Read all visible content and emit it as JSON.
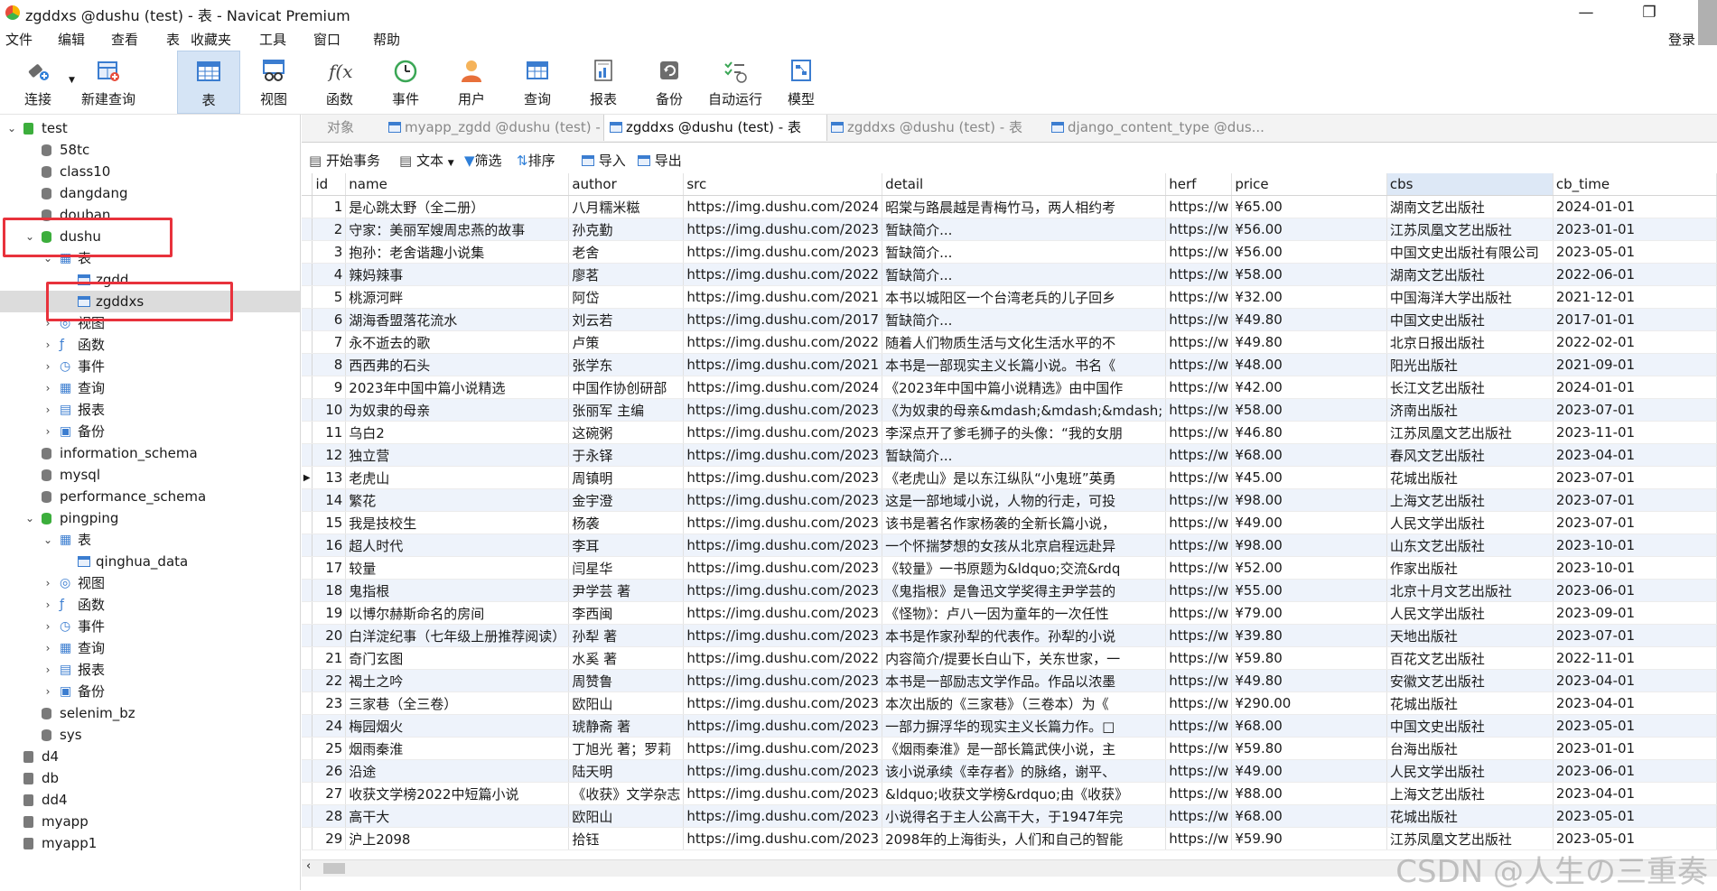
{
  "window": {
    "title": "zgddxs @dushu (test) - 表 - Navicat Premium",
    "minimize": "—",
    "maximize": "❐",
    "close": ""
  },
  "menu": [
    "文件",
    "编辑",
    "查看",
    "表",
    "收藏夹",
    "工具",
    "窗口",
    "帮助"
  ],
  "login": "登录",
  "toolbar": [
    {
      "label": "连接",
      "icon": "plug-icon"
    },
    {
      "label": "新建查询",
      "icon": "new-query-icon"
    },
    {
      "label": "表",
      "icon": "table-icon"
    },
    {
      "label": "视图",
      "icon": "view-icon"
    },
    {
      "label": "函数",
      "icon": "function-icon"
    },
    {
      "label": "事件",
      "icon": "clock-icon"
    },
    {
      "label": "用户",
      "icon": "user-icon"
    },
    {
      "label": "查询",
      "icon": "query-icon"
    },
    {
      "label": "报表",
      "icon": "report-icon"
    },
    {
      "label": "备份",
      "icon": "backup-icon"
    },
    {
      "label": "自动运行",
      "icon": "autorun-icon"
    },
    {
      "label": "模型",
      "icon": "model-icon"
    }
  ],
  "tree": [
    {
      "label": "test",
      "level": 0,
      "type": "conn"
    },
    {
      "label": "58tc",
      "level": 1,
      "type": "db"
    },
    {
      "label": "class10",
      "level": 1,
      "type": "db"
    },
    {
      "label": "dangdang",
      "level": 1,
      "type": "db"
    },
    {
      "label": "douban",
      "level": 1,
      "type": "db"
    },
    {
      "label": "dushu",
      "level": 1,
      "type": "dbopen"
    },
    {
      "label": "表",
      "level": 2,
      "type": "group"
    },
    {
      "label": "zgdd",
      "level": 3,
      "type": "table"
    },
    {
      "label": "zgddxs",
      "level": 3,
      "type": "table"
    },
    {
      "label": "视图",
      "level": 2,
      "type": "group"
    },
    {
      "label": "函数",
      "level": 2,
      "type": "group"
    },
    {
      "label": "事件",
      "level": 2,
      "type": "group"
    },
    {
      "label": "查询",
      "level": 2,
      "type": "group"
    },
    {
      "label": "报表",
      "level": 2,
      "type": "group"
    },
    {
      "label": "备份",
      "level": 2,
      "type": "group"
    },
    {
      "label": "information_schema",
      "level": 1,
      "type": "db"
    },
    {
      "label": "mysql",
      "level": 1,
      "type": "db"
    },
    {
      "label": "performance_schema",
      "level": 1,
      "type": "db"
    },
    {
      "label": "pingping",
      "level": 1,
      "type": "dbopen"
    },
    {
      "label": "表",
      "level": 2,
      "type": "group"
    },
    {
      "label": "qinghua_data",
      "level": 3,
      "type": "table"
    },
    {
      "label": "视图",
      "level": 2,
      "type": "group"
    },
    {
      "label": "函数",
      "level": 2,
      "type": "group"
    },
    {
      "label": "事件",
      "level": 2,
      "type": "group"
    },
    {
      "label": "查询",
      "level": 2,
      "type": "group"
    },
    {
      "label": "报表",
      "level": 2,
      "type": "group"
    },
    {
      "label": "备份",
      "level": 2,
      "type": "group"
    },
    {
      "label": "selenim_bz",
      "level": 1,
      "type": "db"
    },
    {
      "label": "sys",
      "level": 1,
      "type": "db"
    },
    {
      "label": "d4",
      "level": 0,
      "type": "conn2"
    },
    {
      "label": "db",
      "level": 0,
      "type": "conn2"
    },
    {
      "label": "dd4",
      "level": 0,
      "type": "conn2"
    },
    {
      "label": "myapp",
      "level": 0,
      "type": "conn2"
    },
    {
      "label": "myapp1",
      "level": 0,
      "type": "conn2"
    }
  ],
  "tabs": [
    {
      "label": "对象",
      "active": false
    },
    {
      "label": "myapp_zgdd @dushu (test) - 表",
      "active": false
    },
    {
      "label": "zgddxs @dushu (test) - 表",
      "active": true
    },
    {
      "label": "zgddxs @dushu (test) - 表",
      "active": false
    },
    {
      "label": "django_content_type @dus...",
      "active": false
    }
  ],
  "subtoolbar": [
    "开始事务",
    "文本",
    "筛选",
    "排序",
    "导入",
    "导出"
  ],
  "columns": [
    "id",
    "name",
    "author",
    "src",
    "detail",
    "herf",
    "price",
    "cbs",
    "cb_time"
  ],
  "rows": [
    [
      "1",
      "是心跳太野（全二册）",
      "八月糯米糍",
      "https://img.dushu.com/2024",
      "昭棠与路晨越是青梅竹马，两人相约考",
      "https://w",
      "¥65.00",
      "湖南文艺出版社",
      "2024-01-01"
    ],
    [
      "2",
      "守家：美丽军嫂周忠燕的故事",
      "孙克勤",
      "https://img.dushu.com/2023",
      "暂缺简介...",
      "https://w",
      "¥56.00",
      "江苏凤凰文艺出版社",
      "2023-01-01"
    ],
    [
      "3",
      "抱孙：老舍谐趣小说集",
      "老舍",
      "https://img.dushu.com/2023",
      "暂缺简介...",
      "https://w",
      "¥56.00",
      "中国文史出版社有限公司",
      "2023-05-01"
    ],
    [
      "4",
      "辣妈辣事",
      "廖茗",
      "https://img.dushu.com/2022",
      "暂缺简介...",
      "https://w",
      "¥58.00",
      "湖南文艺出版社",
      "2022-06-01"
    ],
    [
      "5",
      "桃源河畔",
      "阿岱",
      "https://img.dushu.com/2021",
      "本书以城阳区一个台湾老兵的儿子回乡",
      "https://w",
      "¥32.00",
      "中国海洋大学出版社",
      "2021-12-01"
    ],
    [
      "6",
      "湖海香盟落花流水",
      "刘云若",
      "https://img.dushu.com/2017",
      "暂缺简介...",
      "https://w",
      "¥49.80",
      "中国文史出版社",
      "2017-01-01"
    ],
    [
      "7",
      "永不逝去的歌",
      "卢策",
      "https://img.dushu.com/2022",
      "随着人们物质生活与文化生活水平的不",
      "https://w",
      "¥49.80",
      "北京日报出版社",
      "2022-02-01"
    ],
    [
      "8",
      "西西弗的石头",
      "张学东",
      "https://img.dushu.com/2021",
      "本书是一部现实主义长篇小说。书名《",
      "https://w",
      "¥48.00",
      "阳光出版社",
      "2021-09-01"
    ],
    [
      "9",
      "2023年中国中篇小说精选",
      "中国作协创研部",
      "https://img.dushu.com/2024",
      "《2023年中国中篇小说精选》由中国作",
      "https://w",
      "¥42.00",
      "长江文艺出版社",
      "2024-01-01"
    ],
    [
      "10",
      "为奴隶的母亲",
      "张丽军 主编",
      "https://img.dushu.com/2023",
      "《为奴隶的母亲&mdash;&mdash;&mdash;",
      "https://w",
      "¥58.00",
      "济南出版社",
      "2023-07-01"
    ],
    [
      "11",
      "乌白2",
      "这碗粥",
      "https://img.dushu.com/2023",
      "李深点开了爹毛狮子的头像：“我的女朋",
      "https://w",
      "¥46.80",
      "江苏凤凰文艺出版社",
      "2023-11-01"
    ],
    [
      "12",
      "独立营",
      "于永铎",
      "https://img.dushu.com/2023",
      "暂缺简介...",
      "https://w",
      "¥68.00",
      "春风文艺出版社",
      "2023-04-01"
    ],
    [
      "13",
      "老虎山",
      "周镇明",
      "https://img.dushu.com/2023",
      "《老虎山》是以东江纵队“小鬼班”英勇",
      "https://w",
      "¥45.00",
      "花城出版社",
      "2023-07-01"
    ],
    [
      "14",
      "繁花",
      "金宇澄",
      "https://img.dushu.com/2023",
      "这是一部地域小说，人物的行走，可投",
      "https://w",
      "¥98.00",
      "上海文艺出版社",
      "2023-07-01"
    ],
    [
      "15",
      "我是技校生",
      "杨袭",
      "https://img.dushu.com/2023",
      "该书是著名作家杨袭的全新长篇小说，",
      "https://w",
      "¥49.00",
      "人民文学出版社",
      "2023-07-01"
    ],
    [
      "16",
      "超人时代",
      "李耳",
      "https://img.dushu.com/2023",
      "一个怀揣梦想的女孩从北京启程远赴异",
      "https://w",
      "¥98.00",
      "山东文艺出版社",
      "2023-10-01"
    ],
    [
      "17",
      "较量",
      "闫星华",
      "https://img.dushu.com/2023",
      "《较量》一书原题为&ldquo;交流&rdq",
      "https://w",
      "¥52.00",
      "作家出版社",
      "2023-10-01"
    ],
    [
      "18",
      "鬼指根",
      "尹学芸 著",
      "https://img.dushu.com/2023",
      "《鬼指根》是鲁迅文学奖得主尹学芸的",
      "https://w",
      "¥55.00",
      "北京十月文艺出版社",
      "2023-06-01"
    ],
    [
      "19",
      "以博尔赫斯命名的房间",
      "李西闽",
      "https://img.dushu.com/2023",
      "《怪物》：卢八一因为童年的一次任性",
      "https://w",
      "¥79.00",
      "人民文学出版社",
      "2023-09-01"
    ],
    [
      "20",
      "白洋淀纪事（七年级上册推荐阅读）",
      "孙犁 著",
      "https://img.dushu.com/2023",
      "本书是作家孙犁的代表作。孙犁的小说",
      "https://w",
      "¥39.80",
      "天地出版社",
      "2023-07-01"
    ],
    [
      "21",
      "奇门玄图",
      "水奚 著",
      "https://img.dushu.com/2022",
      "内容简介/提要长白山下，关东世家，一",
      "https://w",
      "¥59.80",
      "百花文艺出版社",
      "2022-11-01"
    ],
    [
      "22",
      "褐土之吟",
      "周赞鲁",
      "https://img.dushu.com/2023",
      "本书是一部励志文学作品。作品以浓墨",
      "https://w",
      "¥49.80",
      "安徽文艺出版社",
      "2023-04-01"
    ],
    [
      "23",
      "三家巷（全三卷）",
      "欧阳山",
      "https://img.dushu.com/2023",
      "本次出版的《三家巷》（三卷本）为《",
      "https://w",
      "¥290.00",
      "花城出版社",
      "2023-04-01"
    ],
    [
      "24",
      "梅园烟火",
      "琥静斋 著",
      "https://img.dushu.com/2023",
      "一部力摒浮华的现实主义长篇力作。□",
      "https://w",
      "¥68.00",
      "中国文史出版社",
      "2023-05-01"
    ],
    [
      "25",
      "烟雨秦淮",
      "丁旭光 著；罗莉",
      "https://img.dushu.com/2023",
      "《烟雨秦淮》是一部长篇武侠小说，主",
      "https://w",
      "¥59.80",
      "台海出版社",
      "2023-01-01"
    ],
    [
      "26",
      "沿途",
      "陆天明",
      "https://img.dushu.com/2023",
      "该小说承续《幸存者》的脉络，谢平、",
      "https://w",
      "¥49.00",
      "人民文学出版社",
      "2023-06-01"
    ],
    [
      "27",
      "收获文学榜2022中短篇小说",
      "《收获》文学杂志",
      "https://img.dushu.com/2023",
      "&ldquo;收获文学榜&rdquo;由《收获》",
      "https://w",
      "¥88.00",
      "上海文艺出版社",
      "2023-04-01"
    ],
    [
      "28",
      "高干大",
      "欧阳山",
      "https://img.dushu.com/2023",
      "小说得名于主人公高干大，于1947年完",
      "https://w",
      "¥68.00",
      "花城出版社",
      "2023-05-01"
    ],
    [
      "29",
      "沪上2098",
      "拾钰",
      "https://img.dushu.com/2023",
      "2098年的上海街头，人们和自己的智能",
      "https://w",
      "¥59.90",
      "江苏凤凰文艺出版社",
      "2023-05-01"
    ]
  ],
  "current_row": 13,
  "watermark": "CSDN @人生の三重奏"
}
